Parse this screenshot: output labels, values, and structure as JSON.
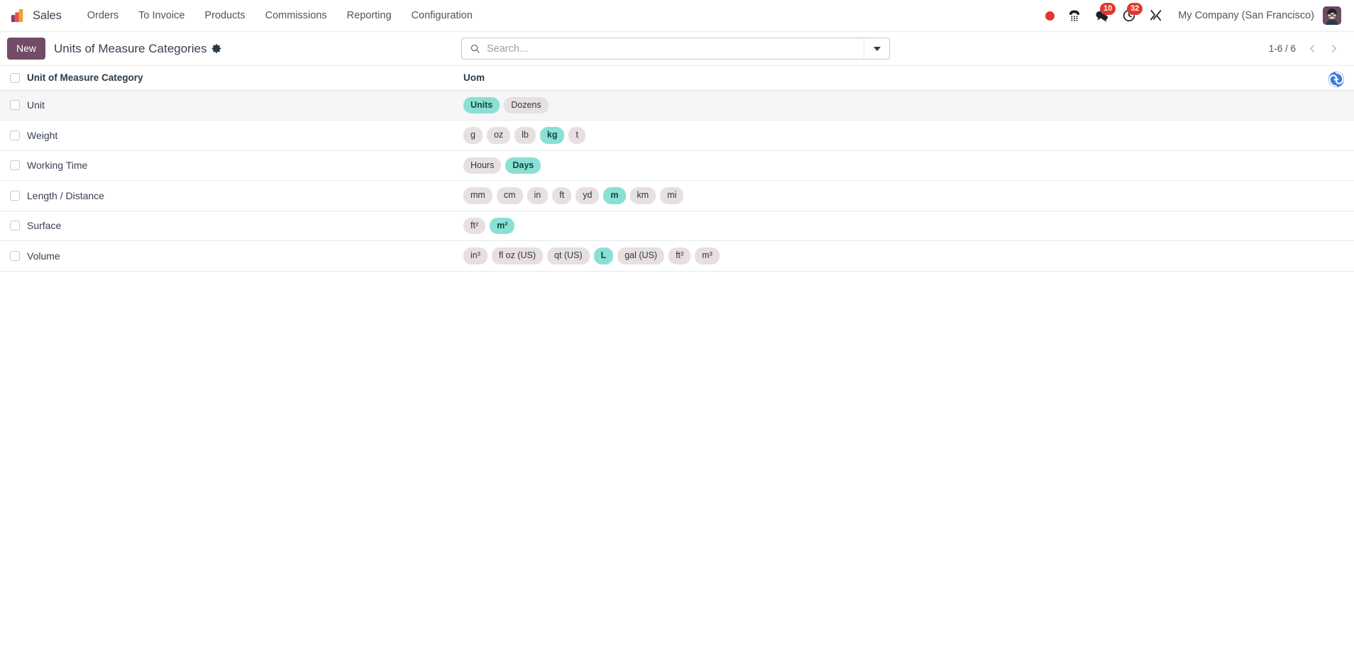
{
  "navbar": {
    "brand": "Sales",
    "brand_logo_icon": "bar-chart-logo-icon",
    "menu_items": [
      {
        "label": "Orders"
      },
      {
        "label": "To Invoice"
      },
      {
        "label": "Products"
      },
      {
        "label": "Commissions"
      },
      {
        "label": "Reporting"
      },
      {
        "label": "Configuration"
      }
    ],
    "systray": {
      "recording_dot_icon": "record-dot-icon",
      "phone_icon": "phone-icon",
      "messages_icon": "messages-icon",
      "messages_count": "10",
      "activities_icon": "clock-activities-icon",
      "activities_count": "32",
      "debug_icon": "wrench-debug-icon",
      "company": "My Company (San Francisco)",
      "avatar_icon": "user-avatar"
    }
  },
  "control_panel": {
    "new_label": "New",
    "title": "Units of Measure Categories",
    "settings_icon": "gear-icon",
    "search": {
      "placeholder": "Search...",
      "value": "",
      "search_icon": "search-icon",
      "dropdown_icon": "chevron-down-icon"
    },
    "pager": {
      "value": "1-6 / 6",
      "previous_icon": "chevron-left-icon",
      "next_icon": "chevron-right-icon"
    }
  },
  "list": {
    "corner_logo_icon": "spiral-logo-icon",
    "columns": {
      "select_all": "select-all-checkbox",
      "name": "Unit of Measure Category",
      "uom": "Uom"
    },
    "rows": [
      {
        "name": "Unit",
        "highlighted": true,
        "uoms": [
          {
            "label": "Units",
            "style": "teal"
          },
          {
            "label": "Dozens",
            "style": "muted"
          }
        ]
      },
      {
        "name": "Weight",
        "highlighted": false,
        "uoms": [
          {
            "label": "g",
            "style": "muted"
          },
          {
            "label": "oz",
            "style": "muted"
          },
          {
            "label": "lb",
            "style": "muted"
          },
          {
            "label": "kg",
            "style": "teal"
          },
          {
            "label": "t",
            "style": "muted"
          }
        ]
      },
      {
        "name": "Working Time",
        "highlighted": false,
        "uoms": [
          {
            "label": "Hours",
            "style": "muted"
          },
          {
            "label": "Days",
            "style": "teal"
          }
        ]
      },
      {
        "name": "Length / Distance",
        "highlighted": false,
        "uoms": [
          {
            "label": "mm",
            "style": "muted"
          },
          {
            "label": "cm",
            "style": "muted"
          },
          {
            "label": "in",
            "style": "muted"
          },
          {
            "label": "ft",
            "style": "muted"
          },
          {
            "label": "yd",
            "style": "muted"
          },
          {
            "label": "m",
            "style": "teal"
          },
          {
            "label": "km",
            "style": "muted"
          },
          {
            "label": "mi",
            "style": "muted"
          }
        ]
      },
      {
        "name": "Surface",
        "highlighted": false,
        "uoms": [
          {
            "label": "ft²",
            "style": "muted"
          },
          {
            "label": "m²",
            "style": "teal"
          }
        ]
      },
      {
        "name": "Volume",
        "highlighted": false,
        "uoms": [
          {
            "label": "in³",
            "style": "muted"
          },
          {
            "label": "fl oz (US)",
            "style": "muted"
          },
          {
            "label": "qt (US)",
            "style": "muted"
          },
          {
            "label": "L",
            "style": "teal"
          },
          {
            "label": "gal (US)",
            "style": "muted"
          },
          {
            "label": "ft³",
            "style": "muted"
          },
          {
            "label": "m³",
            "style": "muted"
          }
        ]
      }
    ]
  },
  "colors": {
    "brand_purple": "#714b67",
    "tag_teal": "#8ae0d4",
    "tag_muted": "#e7dfe0",
    "badge_red": "#e0392b",
    "search_border": "#b9cdd0"
  }
}
